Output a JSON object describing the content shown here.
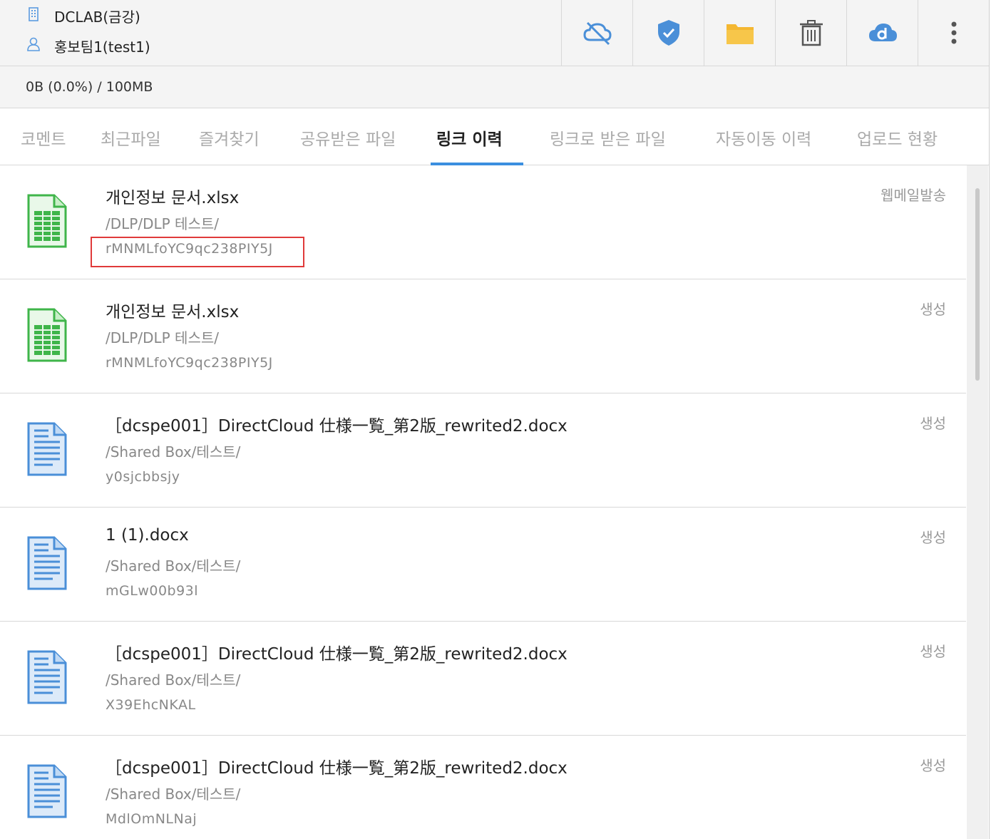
{
  "header": {
    "org": "DCLAB(금강)",
    "user": "홍보팀1(test1)",
    "icons": [
      "cloud-off-icon",
      "shield-check-icon",
      "folder-icon",
      "trash-icon",
      "cloud-d-icon",
      "more-vertical-icon"
    ]
  },
  "quota": {
    "text": "0B (0.0%) / 100MB"
  },
  "tabs": [
    {
      "label": "코멘트"
    },
    {
      "label": "최근파일"
    },
    {
      "label": "즐겨찾기"
    },
    {
      "label": "공유받은 파일"
    },
    {
      "label": "링크 이력",
      "active": true
    },
    {
      "label": "링크로 받은 파일"
    },
    {
      "label": "자동이동 이력"
    },
    {
      "label": "업로드 현황"
    }
  ],
  "rows": [
    {
      "type": "xlsx",
      "name": "개인정보 문서.xlsx",
      "path": "/DLP/DLP 테스트/",
      "code": "rMNMLfoYC9qc238PIY5J",
      "action": "웹메일발송"
    },
    {
      "type": "xlsx",
      "name": "개인정보 문서.xlsx",
      "path": "/DLP/DLP 테스트/",
      "code": "rMNMLfoYC9qc238PIY5J",
      "action": "생성"
    },
    {
      "type": "docx",
      "name": "［dcspe001］DirectCloud 仕様一覧_第2版_rewrited2.docx",
      "path": "/Shared Box/테스트/",
      "code": "y0sjcbbsjy",
      "action": "생성"
    },
    {
      "type": "docx",
      "name": "1 (1).docx",
      "path": "/Shared Box/테스트/",
      "code": "mGLw00b93l",
      "action": "생성"
    },
    {
      "type": "docx",
      "name": "［dcspe001］DirectCloud 仕様一覧_第2版_rewrited2.docx",
      "path": "/Shared Box/테스트/",
      "code": "X39EhcNKAL",
      "action": "생성"
    },
    {
      "type": "docx",
      "name": "［dcspe001］DirectCloud 仕様一覧_第2版_rewrited2.docx",
      "path": "/Shared Box/테스트/",
      "code": "MdlOmNLNaj",
      "action": "생성"
    }
  ],
  "colors": {
    "accent": "#3b8fe0",
    "highlight": "#e03a3a",
    "xlsx_green": "#3fb54a",
    "docx_blue": "#4a8fd8",
    "folder_yellow": "#f4b731"
  }
}
